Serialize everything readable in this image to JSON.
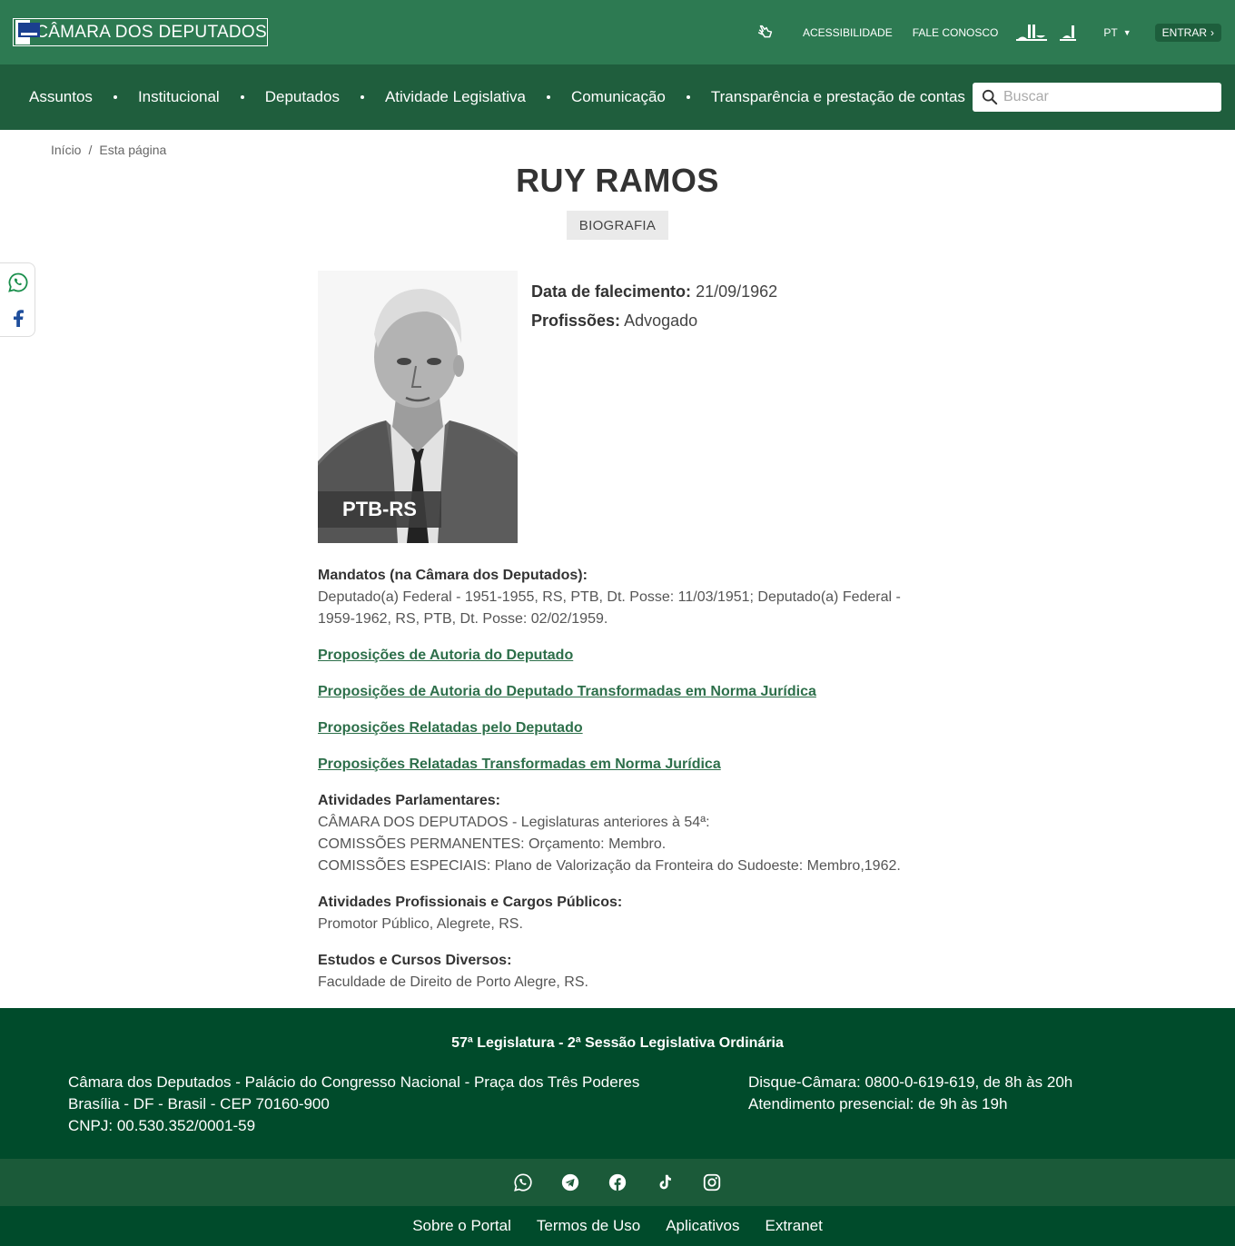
{
  "header": {
    "logo_text": "CÂMARA DOS DEPUTADOS",
    "links": {
      "accessibility": "ACESSIBILIDADE",
      "contact": "FALE CONOSCO",
      "language": "PT",
      "login": "ENTRAR"
    }
  },
  "nav": {
    "items": [
      "Assuntos",
      "Institucional",
      "Deputados",
      "Atividade Legislativa",
      "Comunicação",
      "Transparência e prestação de contas"
    ],
    "search_placeholder": "Buscar"
  },
  "breadcrumb": {
    "home": "Início",
    "current": "Esta página"
  },
  "profile": {
    "name": "RUY RAMOS",
    "tag": "BIOGRAFIA",
    "party": "PTB-RS",
    "death_label": "Data de falecimento:",
    "death_value": "21/09/1962",
    "profession_label": "Profissões:",
    "profession_value": "Advogado"
  },
  "sections": {
    "mandates_title": "Mandatos (na Câmara dos Deputados):",
    "mandates_text": "Deputado(a) Federal - 1951-1955, RS, PTB, Dt. Posse: 11/03/1951; Deputado(a) Federal - 1959-1962, RS, PTB, Dt. Posse: 02/02/1959.",
    "links": [
      "Proposições de Autoria do Deputado",
      "Proposições de Autoria do Deputado Transformadas em Norma Jurídica",
      "Proposições Relatadas pelo Deputado",
      "Proposições Relatadas Transformadas em Norma Jurídica"
    ],
    "parl_title": "Atividades Parlamentares:",
    "parl_lines": [
      "CÂMARA DOS DEPUTADOS - Legislaturas anteriores à 54ª:",
      "COMISSÕES PERMANENTES: Orçamento: Membro.",
      "COMISSÕES ESPECIAIS: Plano de Valorização da Fronteira do Sudoeste: Membro,1962."
    ],
    "prof_title": "Atividades Profissionais e Cargos Públicos:",
    "prof_text": "Promotor Público, Alegrete, RS.",
    "study_title": "Estudos e Cursos Diversos:",
    "study_text": "Faculdade de Direito de Porto Alegre, RS."
  },
  "footer": {
    "legislature": "57ª Legislatura - 2ª Sessão Legislativa Ordinária",
    "address": [
      "Câmara dos Deputados - Palácio do Congresso Nacional - Praça dos Três Poderes",
      "Brasília - DF - Brasil - CEP 70160-900",
      "CNPJ: 00.530.352/0001-59"
    ],
    "contact": [
      "Disque-Câmara: 0800-0-619-619, de 8h às 20h",
      "Atendimento presencial: de 9h às 19h"
    ],
    "social_icons": [
      "whatsapp-icon",
      "telegram-icon",
      "facebook-icon",
      "tiktok-icon",
      "instagram-icon"
    ],
    "links": [
      "Sobre o Portal",
      "Termos de Uso",
      "Aplicativos",
      "Extranet"
    ]
  },
  "colors": {
    "topbar": "#2d7a52",
    "nav": "#1f5e3d",
    "footer": "#004b2b",
    "link": "#2d6f4a"
  }
}
